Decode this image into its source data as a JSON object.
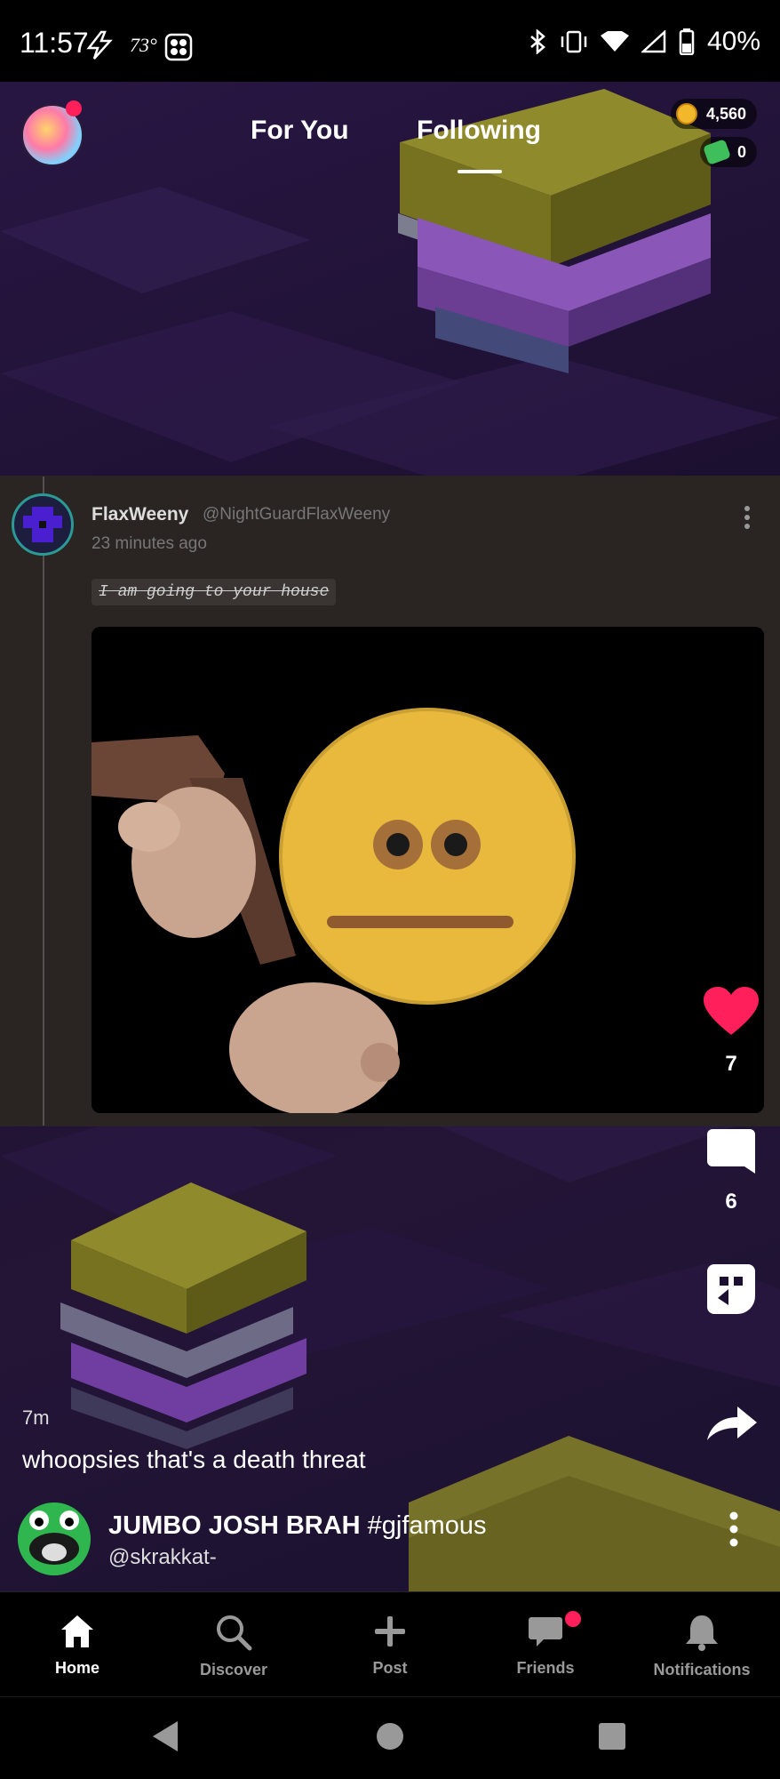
{
  "status_bar": {
    "time": "11:57",
    "temperature": "73°",
    "battery": "40%"
  },
  "header": {
    "tabs": [
      {
        "label": "For You",
        "active": false
      },
      {
        "label": "Following",
        "active": true
      }
    ],
    "coins": "4,560",
    "gems": "0"
  },
  "embedded_post": {
    "display_name": "FlaxWeeny",
    "handle": "@NightGuardFlaxWeeny",
    "timestamp": "23 minutes ago",
    "tag_text": "I am going to your house"
  },
  "actions": {
    "likes": "7",
    "comments": "6"
  },
  "post": {
    "age": "7m",
    "caption": "whoopsies that's a death threat",
    "author_name": "JUMBO JOSH BRAH",
    "author_tag": "#gjfamous",
    "author_handle": "@skrakkat-"
  },
  "bottom_nav": {
    "items": [
      {
        "label": "Home",
        "icon": "home-icon",
        "active": true
      },
      {
        "label": "Discover",
        "icon": "search-icon",
        "active": false
      },
      {
        "label": "Post",
        "icon": "plus-icon",
        "active": false
      },
      {
        "label": "Friends",
        "icon": "chat-icon",
        "active": false,
        "badge": true
      },
      {
        "label": "Notifications",
        "icon": "bell-icon",
        "active": false
      }
    ]
  },
  "colors": {
    "like_red": "#ff1f5a",
    "accent_white": "#ffffff",
    "card_bg": "#2a2523"
  }
}
